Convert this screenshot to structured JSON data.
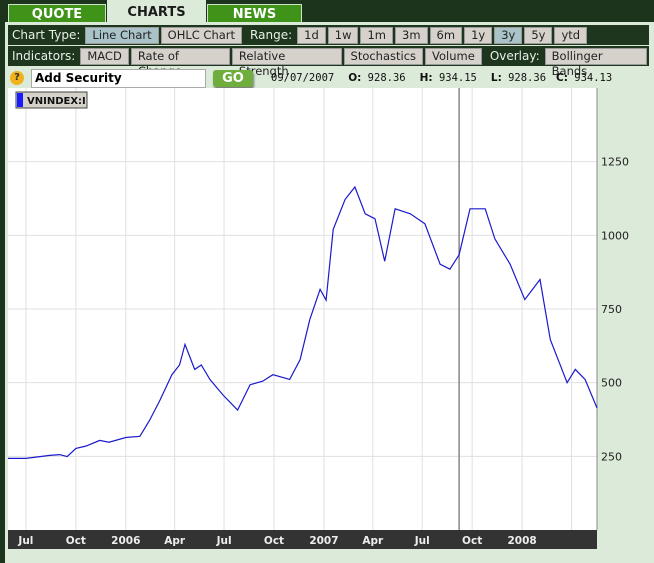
{
  "tabs": [
    {
      "label": "QUOTE"
    },
    {
      "label": "CHARTS",
      "active": true
    },
    {
      "label": "NEWS"
    }
  ],
  "toolbar": {
    "chart_type_label": "Chart Type:",
    "chart_types": [
      {
        "label": "Line Chart",
        "selected": true
      },
      {
        "label": "OHLC Chart"
      }
    ],
    "range_label": "Range:",
    "ranges": [
      {
        "label": "1d"
      },
      {
        "label": "1w"
      },
      {
        "label": "1m"
      },
      {
        "label": "3m"
      },
      {
        "label": "6m"
      },
      {
        "label": "1y"
      },
      {
        "label": "3y",
        "selected": true
      },
      {
        "label": "5y"
      },
      {
        "label": "ytd"
      }
    ],
    "indicators_label": "Indicators:",
    "indicators": [
      {
        "label": "MACD"
      },
      {
        "label": "Rate of Change"
      },
      {
        "label": "Relative Strength"
      },
      {
        "label": "Stochastics"
      },
      {
        "label": "Volume"
      }
    ],
    "overlay_label": "Overlay:",
    "overlays": [
      {
        "label": "Bollinger Bands"
      }
    ]
  },
  "security": {
    "help": "?",
    "value": "Add Security",
    "go": "GO"
  },
  "quote": {
    "date": "09/07/2007",
    "o_label": "O:",
    "o": "928.36",
    "h_label": "H:",
    "h": "934.15",
    "l_label": "L:",
    "l": "928.36",
    "c_label": "C:",
    "c": "934.13"
  },
  "colors": {
    "line": "#1a1acc",
    "accent": "#3e9318",
    "selected": "#a9c3c9"
  },
  "chart_data": {
    "type": "line",
    "legend": "VNINDEX:I",
    "legend_placement": "top-left",
    "grid": true,
    "ylim": [
      0,
      1500
    ],
    "yticks": [
      250,
      500,
      750,
      1000,
      1250
    ],
    "xlim": [
      "2005-05-29",
      "2008-05-18"
    ],
    "xticks": [
      {
        "date": "2005-07-01",
        "label": "Jul"
      },
      {
        "date": "2005-10-01",
        "label": "Oct"
      },
      {
        "date": "2006-01-01",
        "label": "2006"
      },
      {
        "date": "2006-04-01",
        "label": "Apr"
      },
      {
        "date": "2006-07-01",
        "label": "Jul"
      },
      {
        "date": "2006-10-01",
        "label": "Oct"
      },
      {
        "date": "2007-01-01",
        "label": "2007"
      },
      {
        "date": "2007-04-01",
        "label": "Apr"
      },
      {
        "date": "2007-07-01",
        "label": "Jul"
      },
      {
        "date": "2007-10-01",
        "label": "Oct"
      },
      {
        "date": "2008-01-01",
        "label": "2008"
      },
      {
        "date": "2008-04-01",
        "label": ""
      }
    ],
    "cursor_date": "2007-09-07",
    "series": [
      {
        "name": "VNINDEX:I",
        "points": [
          [
            "2005-05-29",
            243
          ],
          [
            "2005-07-01",
            243
          ],
          [
            "2005-08-14",
            253
          ],
          [
            "2005-09-01",
            256
          ],
          [
            "2005-09-15",
            249
          ],
          [
            "2005-10-01",
            277
          ],
          [
            "2005-10-20",
            285
          ],
          [
            "2005-11-14",
            304
          ],
          [
            "2005-12-01",
            298
          ],
          [
            "2006-01-01",
            314
          ],
          [
            "2006-01-27",
            318
          ],
          [
            "2006-02-14",
            373
          ],
          [
            "2006-03-05",
            441
          ],
          [
            "2006-03-27",
            527
          ],
          [
            "2006-04-10",
            560
          ],
          [
            "2006-04-20",
            630
          ],
          [
            "2006-05-08",
            545
          ],
          [
            "2006-05-20",
            560
          ],
          [
            "2006-06-05",
            511
          ],
          [
            "2006-06-29",
            458
          ],
          [
            "2006-07-26",
            407
          ],
          [
            "2006-08-18",
            493
          ],
          [
            "2006-09-10",
            505
          ],
          [
            "2006-09-29",
            527
          ],
          [
            "2006-10-30",
            511
          ],
          [
            "2006-11-18",
            578
          ],
          [
            "2006-12-06",
            714
          ],
          [
            "2006-12-25",
            817
          ],
          [
            "2007-01-05",
            780
          ],
          [
            "2007-01-18",
            1020
          ],
          [
            "2007-02-09",
            1122
          ],
          [
            "2007-02-27",
            1164
          ],
          [
            "2007-03-18",
            1073
          ],
          [
            "2007-04-05",
            1056
          ],
          [
            "2007-04-23",
            912
          ],
          [
            "2007-05-12",
            1090
          ],
          [
            "2007-06-09",
            1073
          ],
          [
            "2007-07-06",
            1039
          ],
          [
            "2007-08-03",
            902
          ],
          [
            "2007-08-21",
            885
          ],
          [
            "2007-09-07",
            934
          ],
          [
            "2007-09-27",
            1090
          ],
          [
            "2007-10-25",
            1090
          ],
          [
            "2007-11-12",
            988
          ],
          [
            "2007-12-10",
            902
          ],
          [
            "2008-01-06",
            782
          ],
          [
            "2008-02-03",
            850
          ],
          [
            "2008-02-22",
            646
          ],
          [
            "2008-03-11",
            561
          ],
          [
            "2008-03-24",
            500
          ],
          [
            "2008-04-08",
            545
          ],
          [
            "2008-04-26",
            511
          ],
          [
            "2008-05-18",
            414
          ]
        ]
      }
    ]
  }
}
